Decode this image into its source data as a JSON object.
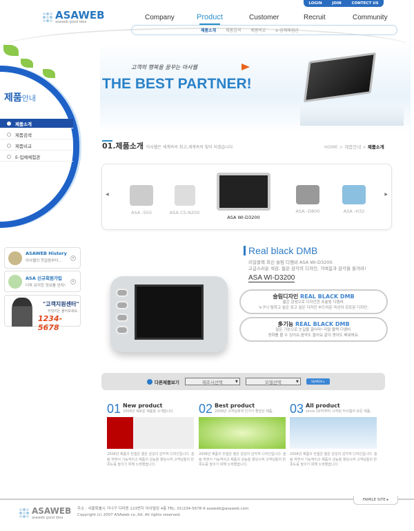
{
  "top_links": [
    "LOGIN",
    "JOIN",
    "CONTECT US"
  ],
  "logo": {
    "name": "ASAWEB",
    "tagline": "asaweb good idea"
  },
  "nav": [
    "Company",
    "Product",
    "Customer",
    "Recruit",
    "Community"
  ],
  "subnav": [
    "제품소개",
    "제품검색",
    "제품비교",
    "e-입체체험관"
  ],
  "sidebar": {
    "title_bold": "제품",
    "title_light": "안내",
    "items": [
      "제품소개",
      "제품검색",
      "제품비교",
      "E-입체체험관"
    ]
  },
  "banner": {
    "subtitle": "고객의 행복을 꿈꾸는 아사웹",
    "title": "THE BEST PARTNER!"
  },
  "section": {
    "num": "01",
    "title": "제품소개",
    "desc": "아사웹은 세계속의 최고,세계속의 빛이 되겠습니다.",
    "breadcrumb": [
      "HOME",
      "제품안내",
      "제품소개"
    ]
  },
  "carousel": [
    "ASA -S50",
    "ASA CS-N200",
    "ASA WI-D3200",
    "ASA -D800",
    "ASA -H32"
  ],
  "widgets": [
    {
      "title": "ASAWEB History",
      "desc": "아사웹의 첫걸음부터..."
    },
    {
      "title": "ASA 신규회원가입",
      "desc": "더욱 유익한 정보를 얻자!"
    }
  ],
  "customer_center": {
    "title": "\"고객지원센터\"",
    "desc": "무엇이든 물어보세요.",
    "phone": "1234-5678"
  },
  "product": {
    "title": "Real black DMB",
    "desc1": "리얼블랙 최신 슬림 디엠비 ASA WI-D3200.",
    "desc2": "고급스러운 색감, 젊은 감각의 디자인, 가벼움과 감각을 즐겨라!",
    "model": "ASA WI-D3200",
    "features": [
      {
        "h": "슬림디자인",
        "hb": "REAL BLACK DMB",
        "l1": "젊은 감성으로 디자인한 초슬림 디엠비.",
        "l2": "누구나 탐하고 싶은 갖고 싶은 디자인 부드러운 곡선이 강조된 디자인."
      },
      {
        "h": "多기능",
        "hb": "REAL BLACK DMB",
        "l1": "많은 기능으로 눈길을 끌어라! 리얼 블랙 디엠비.",
        "l2": "영화를 볼 수 있어요.음악도 들어요.같이 영어도 배워봐요."
      }
    ]
  },
  "search": {
    "label": "다른제품보기",
    "maker": "제조사선택",
    "model": "모델선택",
    "button": "SEARCH ▸"
  },
  "columns": [
    {
      "num": "01",
      "title": "New product",
      "sub": "2008년 새로운 제품을 소개합니다."
    },
    {
      "num": "02",
      "title": "Best product",
      "sub": "2008년 고객님에게 인기가 좋았던 제품."
    },
    {
      "num": "03",
      "title": "All product",
      "sub": "since 1970부터 시작된 아사웹의 모든 제품."
    }
  ],
  "column_desc": "2008년 제품의 컨셉은 젊은 감성의 감각적 디자인입니다. 슬림 하면서 기능적이고 제품의 성능을 향상시켜 고객님들의 만족도를 높이기 위해 노력했습니다.",
  "footer": {
    "famile": "FAMILE SITE ▸",
    "address": "주소 : 서울특별시 가나구 다라동 123번지 아사빌딩 4층 TEL: 01)234-5678-9 asaweb@asaweb.com",
    "copyright": "Copyright (c) 2007 ASAweb  co.,ltd. All rights reserved."
  },
  "colors": {
    "accent": "#2a7ac8",
    "sidebar_active": "#1e4fa6",
    "phone": "#e0461a"
  }
}
